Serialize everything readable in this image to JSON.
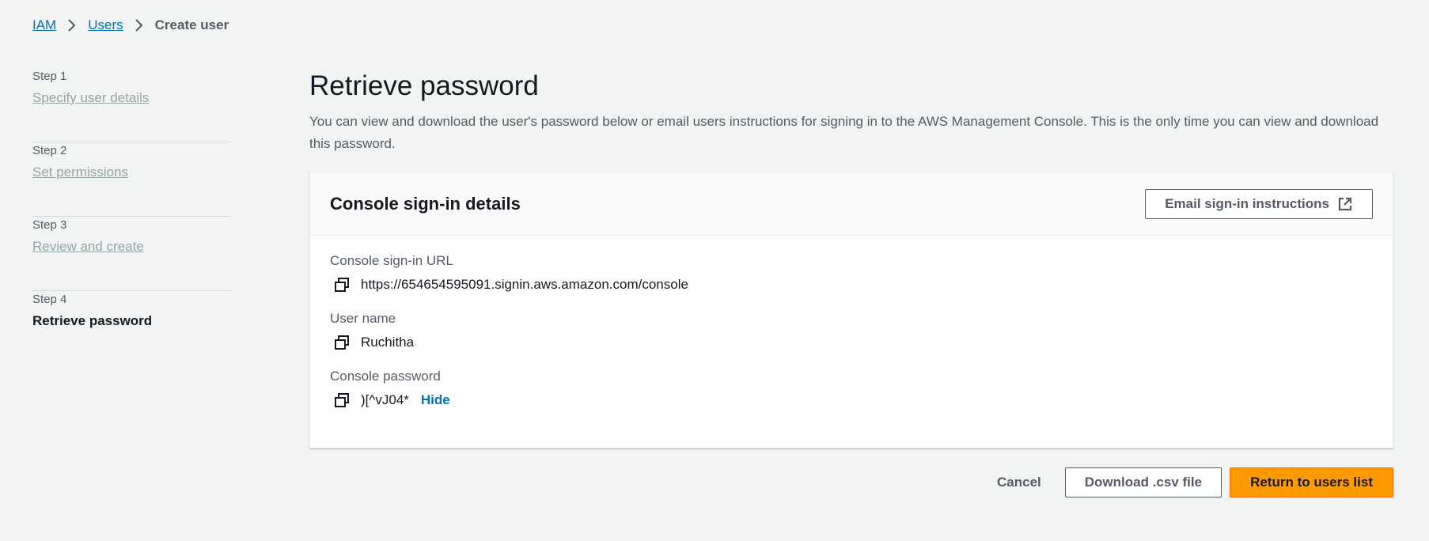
{
  "breadcrumb": {
    "items": [
      "IAM",
      "Users"
    ],
    "current": "Create user"
  },
  "steps": [
    {
      "number": "Step 1",
      "label": "Specify user details"
    },
    {
      "number": "Step 2",
      "label": "Set permissions"
    },
    {
      "number": "Step 3",
      "label": "Review and create"
    },
    {
      "number": "Step 4",
      "label": "Retrieve password"
    }
  ],
  "main": {
    "title": "Retrieve password",
    "description": "You can view and download the user's password below or email users instructions for signing in to the AWS Management Console. This is the only time you can view and download this password."
  },
  "card": {
    "title": "Console sign-in details",
    "email_button": "Email sign-in instructions",
    "fields": {
      "url_label": "Console sign-in URL",
      "url_value": "https://654654595091.signin.aws.amazon.com/console",
      "username_label": "User name",
      "username_value": "Ruchitha",
      "password_label": "Console password",
      "password_value": ")[^vJ04*",
      "hide_link": "Hide"
    }
  },
  "footer": {
    "cancel": "Cancel",
    "download": "Download .csv file",
    "return": "Return to users list"
  },
  "colors": {
    "link": "#0073bb",
    "primary": "#ff9900",
    "background": "#f2f3f3"
  },
  "icons": [
    "chevron-right-icon",
    "copy-icon",
    "external-link-icon"
  ]
}
